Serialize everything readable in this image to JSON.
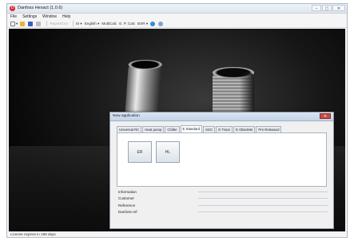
{
  "window": {
    "title": "Danfoss Hexact (1.0.6)",
    "controls": [
      "–",
      "▢",
      "✕"
    ]
  },
  "menu": [
    "File",
    "Settings",
    "Window",
    "Help"
  ],
  "toolbar": {
    "report_label": "Report/Out",
    "si_label": "SI",
    "language_label": "English",
    "multicalc_label": "MultiCalc",
    "ep_calc_label": "E. P. Calc",
    "bkr_label": "BXR"
  },
  "dialog": {
    "title": "New application",
    "close_label": "✕",
    "tabs": [
      "Universal RC",
      "Heat pump",
      "Chiller",
      "E Standard",
      "SGC",
      "E Trace",
      "E Obsolete",
      "Pre Released"
    ],
    "active_tab": 3,
    "buttons": [
      "ER",
      "HL"
    ],
    "info_rows": [
      "Information",
      "Customer",
      "Reference",
      "Danfoss ref"
    ]
  },
  "status": {
    "text": "License expires in 189 days"
  },
  "colors": {
    "app_icon": "#d32a2a",
    "dialog_close": "#c94a3e",
    "titlebar": "#dde6f1"
  }
}
